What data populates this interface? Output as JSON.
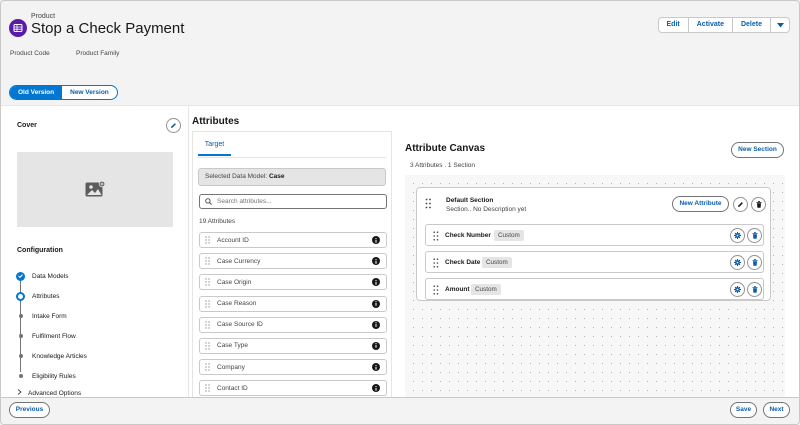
{
  "header": {
    "eyebrow": "Product",
    "title": "Stop a Check Payment",
    "actions": [
      "Edit",
      "Activate",
      "Delete"
    ],
    "meta": [
      "Product Code",
      "Product Family"
    ],
    "icon": "product-icon"
  },
  "version_toggle": {
    "selected": "Old Version",
    "other": "New Version"
  },
  "left": {
    "cover_label": "Cover",
    "configuration_label": "Configuration",
    "steps": [
      {
        "label": "Data Models",
        "state": "complete"
      },
      {
        "label": "Attributes",
        "state": "current"
      },
      {
        "label": "Intake Form",
        "state": "pending"
      },
      {
        "label": "Fulfilment Flow",
        "state": "pending"
      },
      {
        "label": "Knowledge Articles",
        "state": "pending"
      },
      {
        "label": "Eligibility Rules",
        "state": "pending"
      }
    ],
    "advanced": "Advanced Options"
  },
  "attributes": {
    "title": "Attributes",
    "tab": "Target",
    "model_prefix": "Selected Data Model:",
    "model": "Case",
    "search_placeholder": "Search attributes...",
    "count": "19 Attributes",
    "items": [
      "Account ID",
      "Case Currency",
      "Case Origin",
      "Case Reason",
      "Case Source ID",
      "Case Type",
      "Company",
      "Contact ID"
    ]
  },
  "canvas": {
    "title": "Attribute Canvas",
    "summary": "3 Attributes . 1 Section",
    "new_section": "New Section",
    "section": {
      "name": "Default Section",
      "description": "Section.. No Description yet",
      "new_attribute": "New Attribute",
      "fields": [
        {
          "name": "Check Number",
          "tag": "Custom"
        },
        {
          "name": "Check Date",
          "tag": "Custom"
        },
        {
          "name": "Amount",
          "tag": "Custom"
        }
      ]
    }
  },
  "footer": {
    "previous": "Previous",
    "save": "Save",
    "next": "Next"
  },
  "colors": {
    "brand": "#0176d3",
    "icon_bg": "#5a1ba9",
    "link": "#0b5cab"
  }
}
